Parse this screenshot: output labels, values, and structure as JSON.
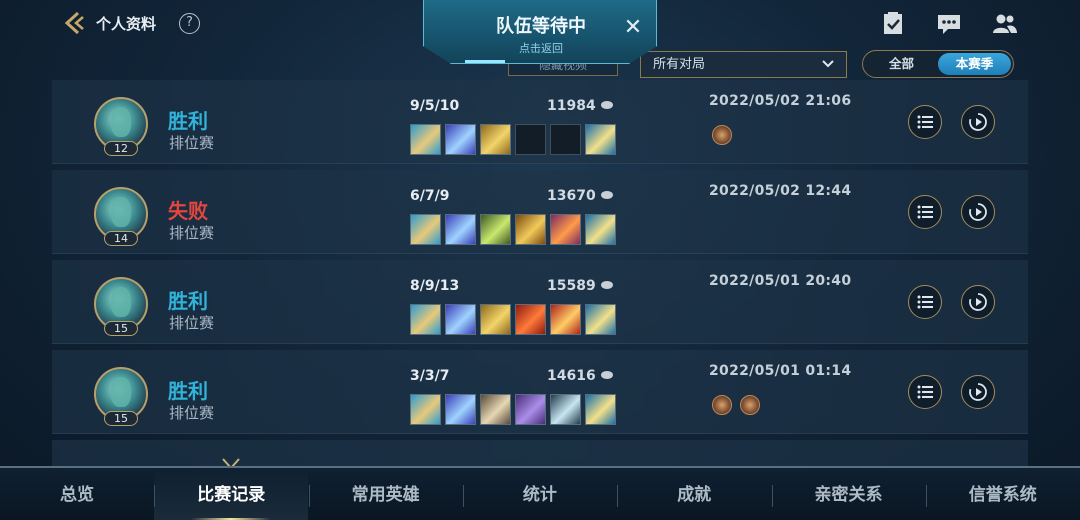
{
  "header": {
    "title": "个人资料",
    "help_label": "?",
    "back_icon": "back-arrow-icon",
    "icons": [
      "task-checklist-icon",
      "chat-message-icon",
      "friends-icon"
    ]
  },
  "banner": {
    "title": "队伍等待中",
    "subtitle": "点击返回",
    "close_label": "✕"
  },
  "filters": {
    "hidden_filter_label": "隐藏视频",
    "match_type_selected": "所有对局",
    "toggle": [
      "全部",
      "本赛季"
    ],
    "toggle_active": "本赛季"
  },
  "matches": [
    {
      "result": "胜利",
      "outcome": "win",
      "mode": "排位赛",
      "level": "12",
      "kda": "9/5/10",
      "gold": "11984",
      "date": "2022/05/02 21:06",
      "medals": 1,
      "items": [
        "boots",
        "staff",
        "claw",
        "empty",
        "empty",
        "armor"
      ]
    },
    {
      "result": "失败",
      "outcome": "lose",
      "mode": "排位赛",
      "level": "14",
      "kda": "6/7/9",
      "gold": "13670",
      "date": "2022/05/02 12:44",
      "medals": 0,
      "items": [
        "boots",
        "staff",
        "blade",
        "sword",
        "cape",
        "armor"
      ]
    },
    {
      "result": "胜利",
      "outcome": "win",
      "mode": "排位赛",
      "level": "15",
      "kda": "8/9/13",
      "gold": "15589",
      "date": "2022/05/01 20:40",
      "medals": 0,
      "items": [
        "boots",
        "staff",
        "claw",
        "fire",
        "potion",
        "armor"
      ]
    },
    {
      "result": "胜利",
      "outcome": "win",
      "mode": "排位赛",
      "level": "15",
      "kda": "3/3/7",
      "gold": "14616",
      "date": "2022/05/01 01:14",
      "medals": 2,
      "items": [
        "boots",
        "staff",
        "dagger",
        "wing",
        "scythe",
        "armor"
      ]
    }
  ],
  "tabs": [
    "总览",
    "比赛记录",
    "常用英雄",
    "统计",
    "成就",
    "亲密关系",
    "信誉系统"
  ],
  "active_tab": "比赛记录",
  "colors": {
    "win": "#31b4da",
    "lose": "#e3463e",
    "accent_gold": "#b9a06a",
    "toggle_active": "#2a94cc"
  }
}
